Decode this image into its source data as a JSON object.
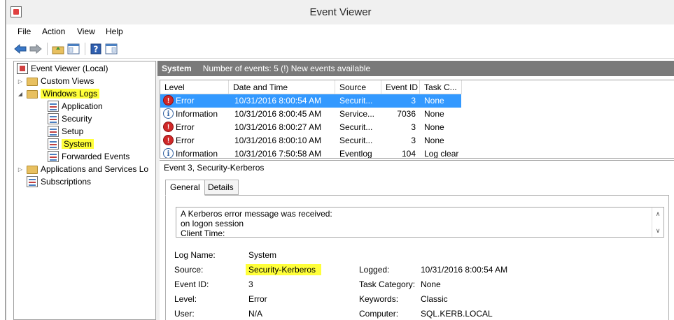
{
  "window": {
    "title": "Event Viewer"
  },
  "menu": [
    "File",
    "Action",
    "View",
    "Help"
  ],
  "tree": {
    "root": "Event Viewer (Local)",
    "custom_views": "Custom Views",
    "windows_logs": "Windows Logs",
    "application": "Application",
    "security": "Security",
    "setup": "Setup",
    "system": "System",
    "forwarded": "Forwarded Events",
    "apps_services": "Applications and Services Lo",
    "subscriptions": "Subscriptions"
  },
  "header": {
    "name": "System",
    "info": "Number of events: 5 (!) New events available"
  },
  "columns": [
    "Level",
    "Date and Time",
    "Source",
    "Event ID",
    "Task C..."
  ],
  "events": [
    {
      "level": "Error",
      "kind": "error",
      "datetime": "10/31/2016 8:00:54 AM",
      "source": "Securit...",
      "id": "3",
      "task": "None",
      "selected": true
    },
    {
      "level": "Information",
      "kind": "info",
      "datetime": "10/31/2016 8:00:45 AM",
      "source": "Service...",
      "id": "7036",
      "task": "None",
      "selected": false
    },
    {
      "level": "Error",
      "kind": "error",
      "datetime": "10/31/2016 8:00:27 AM",
      "source": "Securit...",
      "id": "3",
      "task": "None",
      "selected": false
    },
    {
      "level": "Error",
      "kind": "error",
      "datetime": "10/31/2016 8:00:10 AM",
      "source": "Securit...",
      "id": "3",
      "task": "None",
      "selected": false
    },
    {
      "level": "Information",
      "kind": "info",
      "datetime": "10/31/2016 7:50:58 AM",
      "source": "Eventlog",
      "id": "104",
      "task": "Log clear",
      "selected": false
    }
  ],
  "detail": {
    "title": "Event 3, Security-Kerberos",
    "tabs": [
      "General",
      "Details"
    ],
    "message_lines": [
      "A Kerberos error message was received:",
      "on logon session",
      "Client Time:"
    ],
    "labels": {
      "log_name": "Log Name:",
      "source": "Source:",
      "event_id": "Event ID:",
      "level": "Level:",
      "user": "User:",
      "logged": "Logged:",
      "task_category": "Task Category:",
      "keywords": "Keywords:",
      "computer": "Computer:"
    },
    "values": {
      "log_name": "System",
      "source": "Security-Kerberos",
      "event_id": "3",
      "level": "Error",
      "user": "N/A",
      "logged": "10/31/2016 8:00:54 AM",
      "task_category": "None",
      "keywords": "Classic",
      "computer": "SQL.KERB.LOCAL"
    }
  },
  "icons": {
    "error_glyph": "!",
    "info_glyph": "i",
    "back": "back-arrow-icon",
    "forward": "forward-arrow-icon",
    "help_glyph": "?"
  }
}
